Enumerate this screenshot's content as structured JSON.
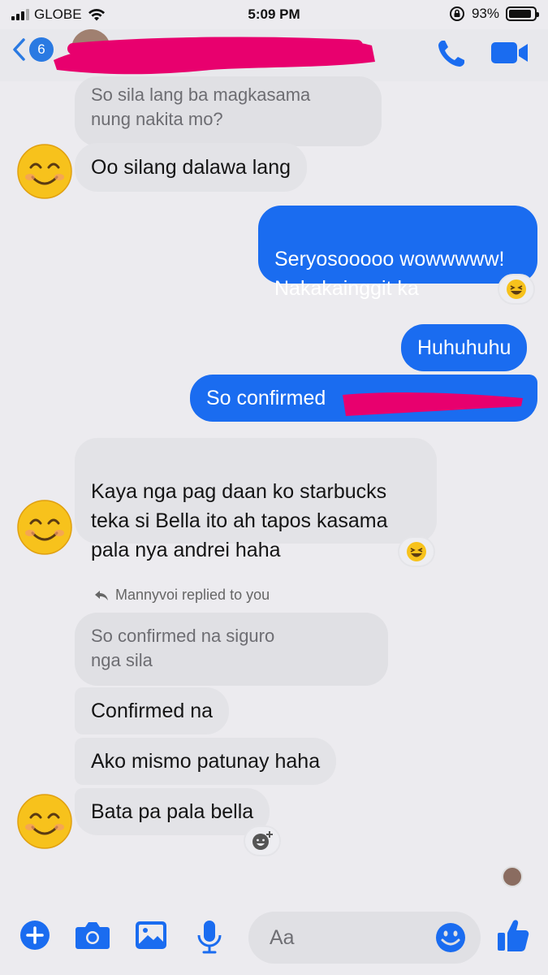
{
  "status_bar": {
    "carrier": "GLOBE",
    "time": "5:09 PM",
    "battery": "93%"
  },
  "header": {
    "unread_count": "6"
  },
  "messages": [
    {
      "id": "m1",
      "text": "So sila lang ba magkasama\nnung nakita mo?",
      "kind": "quote"
    },
    {
      "id": "m2",
      "text": "Oo silang dalawa lang"
    },
    {
      "id": "m3",
      "text": "Seryosooooo wowwwww!\nNakakainggit ka"
    },
    {
      "id": "m4",
      "text": "Huhuhuhu"
    },
    {
      "id": "m5",
      "text": "So confirmed"
    },
    {
      "id": "m6",
      "text": "Kaya nga pag daan ko starbucks\nteka si Bella ito ah tapos kasama\npala nya andrei haha"
    },
    {
      "id": "m7",
      "text": "So confirmed na siguro\nnga sila",
      "kind": "quote"
    },
    {
      "id": "m8",
      "text": "Confirmed na"
    },
    {
      "id": "m9",
      "text": "Ako mismo patunay haha"
    },
    {
      "id": "m10",
      "text": "Bata pa pala bella"
    }
  ],
  "reply_label": "Mannyvoi replied to you",
  "composer": {
    "placeholder": "Aa"
  },
  "colors": {
    "accent": "#1a6cf0",
    "incoming": "#e3e3e7",
    "redaction": "#e8006e"
  },
  "icons": [
    "back-chevron-icon",
    "phone-icon",
    "video-camera-icon",
    "laughing-emoji-icon",
    "add-reaction-icon",
    "reply-arrow-icon",
    "plus-icon",
    "camera-icon",
    "image-icon",
    "microphone-icon",
    "emoji-icon",
    "thumbs-up-icon"
  ]
}
